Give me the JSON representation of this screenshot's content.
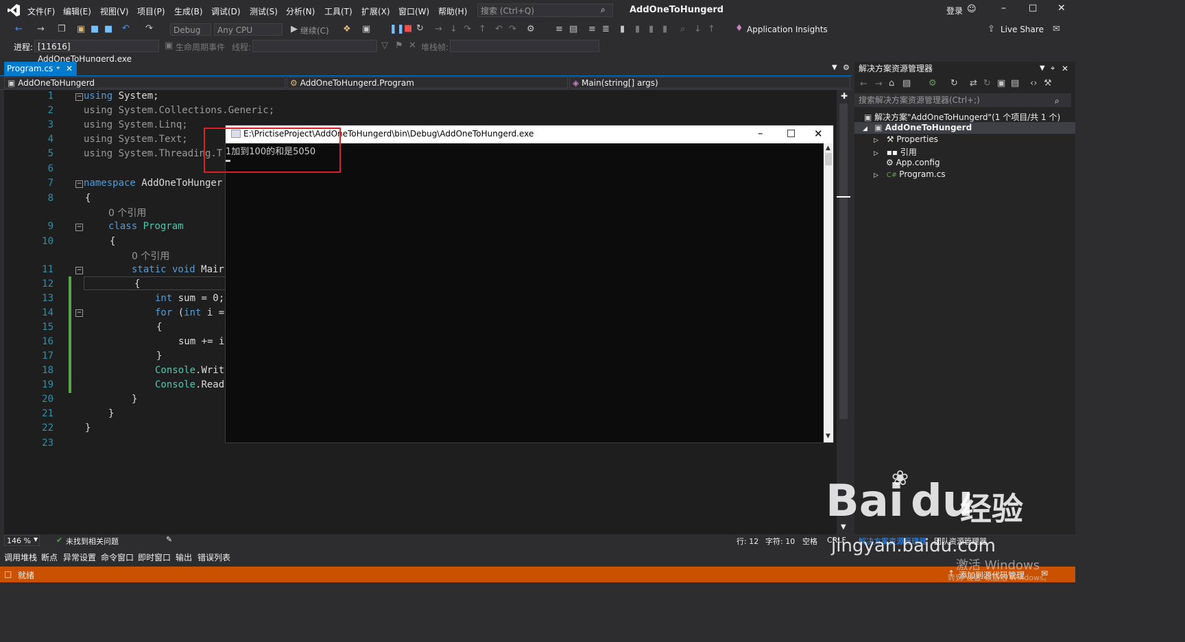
{
  "menu": {
    "items": [
      "文件(F)",
      "编辑(E)",
      "视图(V)",
      "项目(P)",
      "生成(B)",
      "调试(D)",
      "测试(S)",
      "分析(N)",
      "工具(T)",
      "扩展(X)",
      "窗口(W)",
      "帮助(H)"
    ],
    "search_placeholder": "搜索 (Ctrl+Q)",
    "title": "AddOneToHungerd",
    "login": "登录"
  },
  "toolbar": {
    "config": "Debug",
    "platform": "Any CPU",
    "continue": "继续(C)",
    "app_insights": "Application Insights",
    "live_share": "Live Share"
  },
  "toolbar2": {
    "process_label": "进程:",
    "process_value": "[11616] AddOneToHungerd.exe",
    "lifecycle": "生命周期事件",
    "thread_label": "线程:",
    "stack_label": "堆栈帧:"
  },
  "tab": {
    "label": "Program.cs"
  },
  "nav": {
    "project": "AddOneToHungerd",
    "class": "AddOneToHungerd.Program",
    "method": "Main(string[] args)"
  },
  "code": {
    "line_numbers": [
      "1",
      "2",
      "3",
      "4",
      "5",
      "6",
      "7",
      "8",
      "9",
      "10",
      "11",
      "12",
      "13",
      "14",
      "15",
      "16",
      "17",
      "18",
      "19",
      "20",
      "21",
      "22",
      "23"
    ],
    "l1_kw": "using",
    "l1_rest": " System;",
    "l2": "using System.Collections.Generic;",
    "l3": "using System.Linq;",
    "l4": "using System.Text;",
    "l5": "using System.Threading.T",
    "l7_kw": "namespace",
    "l7_rest": " AddOneToHunger",
    "l8": "{",
    "ref_class": "0 个引用",
    "l9_kw": "class",
    "l9_ty": " Program",
    "l10": "{",
    "ref_main": "0 个引用",
    "l11_kw": "static void",
    "l11_rest": " Mair",
    "l12": "{",
    "l13_kw": "int",
    "l13_rest": " sum = 0;",
    "l14_kw": "for",
    "l14_mid": " (",
    "l14_kw2": "int",
    "l14_rest": " i =",
    "l15": "{",
    "l16": "sum += i",
    "l17": "}",
    "l18_ty": "Console",
    "l18_rest": ".Writ",
    "l19_ty": "Console",
    "l19_rest": ".Read",
    "l20": "}",
    "l21": "}",
    "l22": "}"
  },
  "console": {
    "title": "E:\\PrictiseProject\\AddOneToHungerd\\bin\\Debug\\AddOneToHungerd.exe",
    "output": "1加到100的和是5050"
  },
  "solution_explorer": {
    "header": "解决方案资源管理器",
    "search_placeholder": "搜索解决方案资源管理器(Ctrl+;)",
    "solution": "解决方案\"AddOneToHungerd\"(1 个项目/共 1 个)",
    "project": "AddOneToHungerd",
    "items": [
      "Properties",
      "引用",
      "App.config",
      "Program.cs"
    ]
  },
  "editor_status": {
    "zoom": "146 %",
    "issues": "未找到相关问题",
    "row": "行: 12",
    "col": "字符: 10",
    "space": "空格",
    "crlf": "CRLF"
  },
  "bottom_tabs": [
    "调用堆栈",
    "断点",
    "异常设置",
    "命令窗口",
    "即时窗口",
    "输出",
    "错误列表"
  ],
  "se_tabs": [
    "解决方案资源管理器",
    "团队资源管理器"
  ],
  "status": {
    "ready": "就绪",
    "source_control": "添加到源代码管理"
  },
  "watermark": {
    "brand": "Bai",
    "brand2": "du",
    "jingyan": "经验",
    "url": "jingyan.baidu.com",
    "activate": "激活 Windows",
    "activate_sub": "转到\"设置\"以激活 Windows。"
  }
}
